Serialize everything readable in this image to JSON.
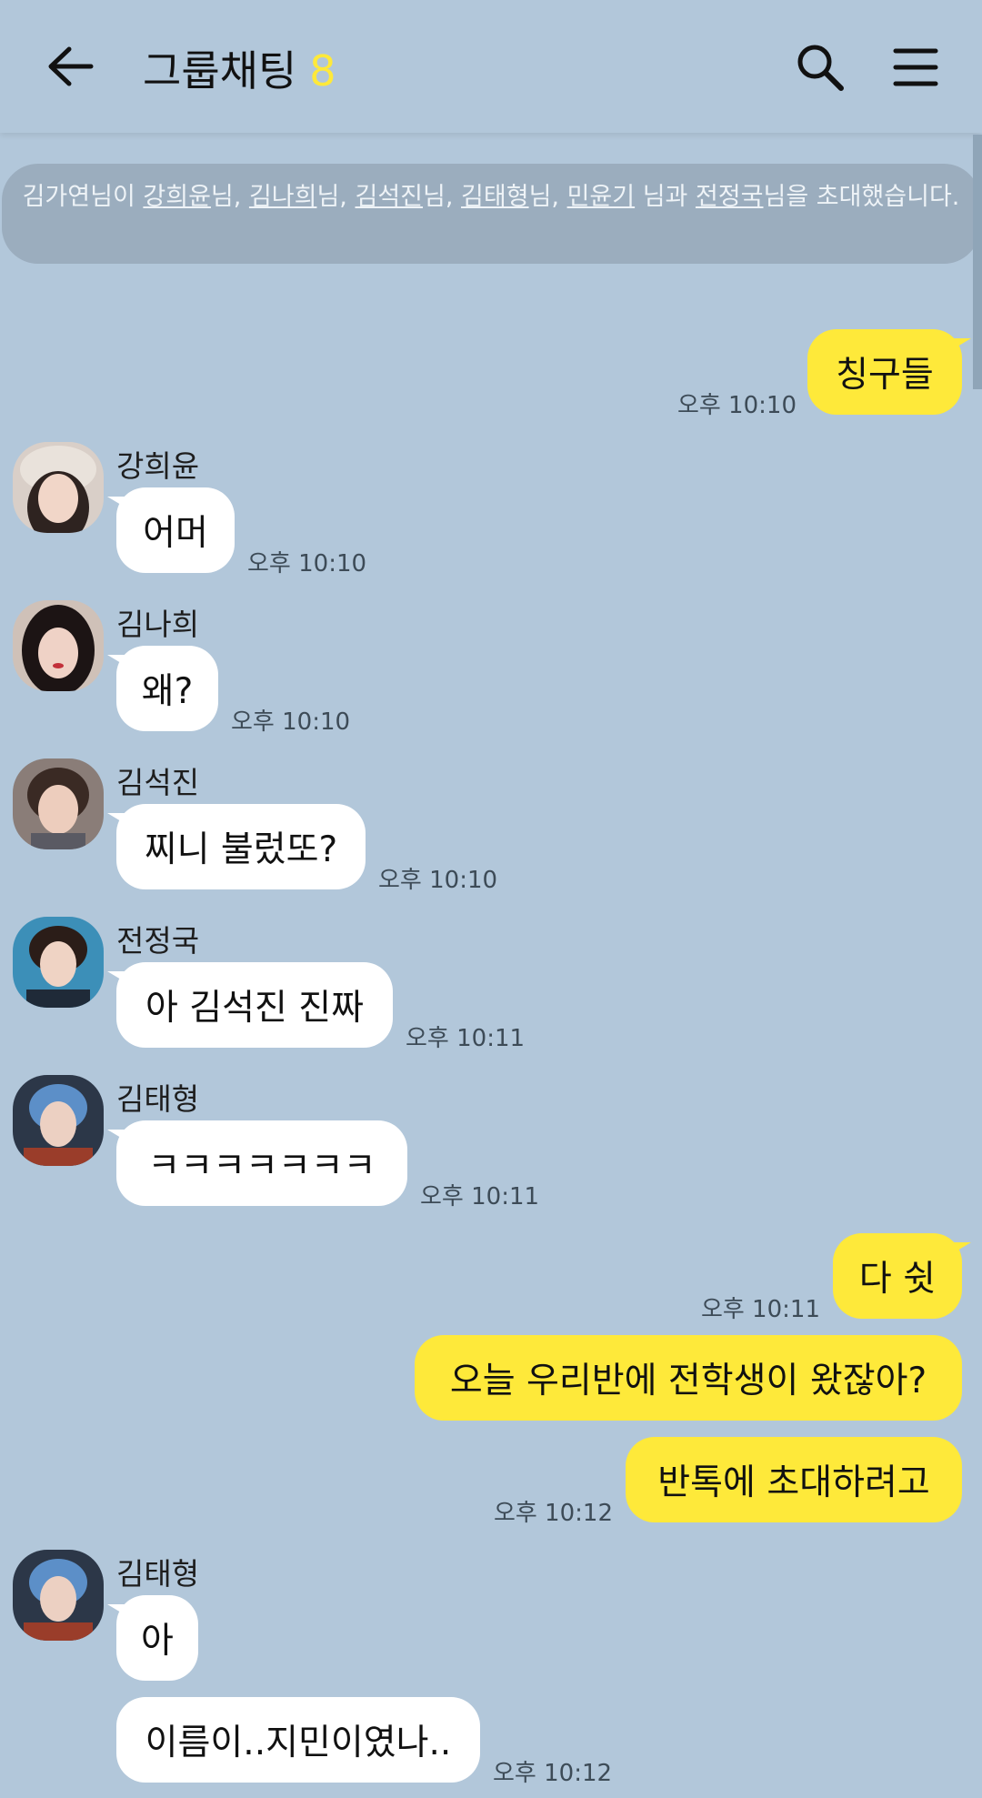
{
  "header": {
    "title": "그룹채팅",
    "member_count": "8",
    "icons": [
      "back-arrow-icon",
      "search-icon",
      "menu-icon"
    ]
  },
  "colors": {
    "background": "#b2c7da",
    "incoming_bubble": "#ffffff",
    "outgoing_bubble": "#fee93a",
    "member_count": "#ffe93a"
  },
  "notice": {
    "inviter": "김가연님이",
    "invitees": [
      "강희윤",
      "김나희",
      "김석진",
      "김태형",
      "민윤기"
    ],
    "last_invitee": "전정국",
    "suffix": "님을 초대했습니다."
  },
  "messages": [
    {
      "direction": "out",
      "text": "칭구들",
      "time": "오후 10:10"
    },
    {
      "direction": "in",
      "sender": "강희윤",
      "text": "어머",
      "time": "오후 10:10"
    },
    {
      "direction": "in",
      "sender": "김나희",
      "text": "왜?",
      "time": "오후 10:10"
    },
    {
      "direction": "in",
      "sender": "김석진",
      "text": "찌니 불렀또?",
      "time": "오후 10:10"
    },
    {
      "direction": "in",
      "sender": "전정국",
      "text": "아 김석진 진짜",
      "time": "오후 10:11"
    },
    {
      "direction": "in",
      "sender": "김태형",
      "text": "ㅋㅋㅋㅋㅋㅋㅋ",
      "time": "오후 10:11"
    },
    {
      "direction": "out",
      "text": "다 쉿",
      "time": "오후 10:11"
    },
    {
      "direction": "out",
      "text": "오늘 우리반에 전학생이 왔잖아?"
    },
    {
      "direction": "out",
      "text": "반톡에 초대하려고",
      "time": "오후 10:12"
    },
    {
      "direction": "in",
      "sender": "김태형",
      "text": "아"
    },
    {
      "direction": "in",
      "text": "이름이..지민이였나..",
      "time": "오후 10:12"
    }
  ]
}
